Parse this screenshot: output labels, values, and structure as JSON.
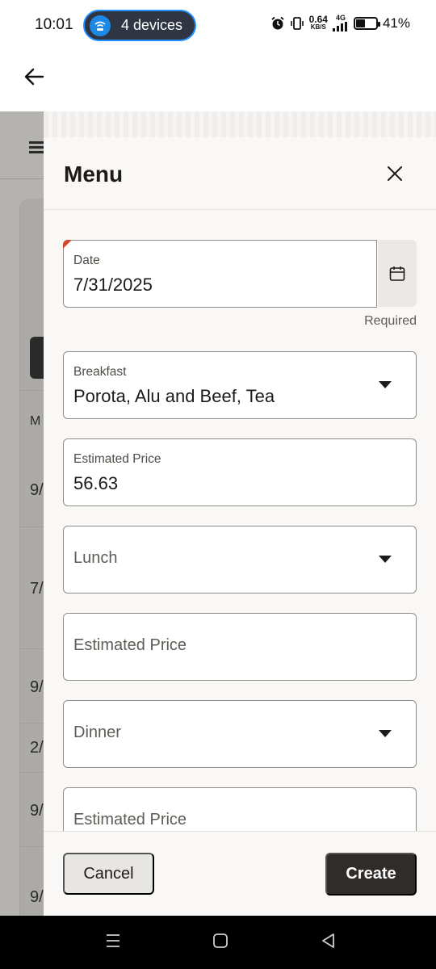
{
  "status_bar": {
    "time": "10:01",
    "hotspot_label": "4 devices",
    "net_speed": "0.64",
    "net_unit": "KB/S",
    "network_type": "4G",
    "battery": "41%"
  },
  "background_page": {
    "column_header": "M",
    "row_values": [
      "9/",
      "7/",
      "9/",
      "2/",
      "9/",
      "9/"
    ]
  },
  "drawer": {
    "title": "Menu",
    "date": {
      "label": "Date",
      "value": "7/31/2025",
      "hint": "Required"
    },
    "breakfast": {
      "label": "Breakfast",
      "value": "Porota, Alu and Beef, Tea"
    },
    "breakfast_price": {
      "label": "Estimated Price",
      "value": "56.63"
    },
    "lunch": {
      "placeholder": "Lunch"
    },
    "lunch_price": {
      "placeholder": "Estimated Price"
    },
    "dinner": {
      "placeholder": "Dinner"
    },
    "dinner_price": {
      "placeholder": "Estimated Price"
    },
    "cancel_label": "Cancel",
    "create_label": "Create"
  },
  "colors": {
    "required_marker": "#d24a2c",
    "primary_button": "#302c29",
    "hotspot_accent": "#1e88e5"
  }
}
